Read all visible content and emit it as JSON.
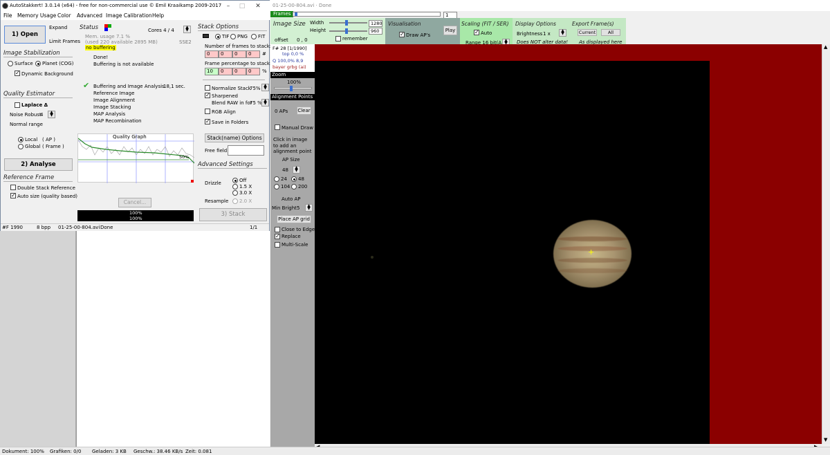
{
  "window": {
    "title": "AutoStakkert! 3.0.14 (x64) - free for non-commercial use © Emil Kraaikamp 2009-2017",
    "menu": [
      "File",
      "Memory Usage",
      "Color",
      "Advanced",
      "Image Calibration",
      "Help"
    ]
  },
  "left": {
    "open_label": "1) Open",
    "expand_label": "Expand",
    "limit_frames_label": "Limit Frames",
    "image_stabilization": "Image Stabilization",
    "surface_label": "Surface",
    "planet_label": "Planet (COG)",
    "dynamic_bg_label": "Dynamic Background",
    "quality_estimator": "Quality Estimator",
    "laplace_label": "Laplace Δ",
    "noise_robust_label": "Noise Robust",
    "noise_robust_value": "4",
    "normal_range_label": "Normal range",
    "local_label": "Local",
    "local_ap": "( AP )",
    "global_label": "Global",
    "global_frame": "( Frame )",
    "analyse_label": "2) Analyse",
    "reference_frame": "Reference Frame",
    "double_stack_label": "Double Stack Reference",
    "auto_size_label": "Auto size (quality based)"
  },
  "status": {
    "title": "Status",
    "cores": "Cores 4 / 4",
    "mem_usage": "Mem. usage 7.1 %",
    "mem_used": "(used 220 available 2895 MB)",
    "no_buffering": "no buffering",
    "sse": "SSE2",
    "done": "Done!",
    "buffering_na": "Buffering is not available",
    "steps": [
      "Buffering and Image Analysis",
      "Reference Image",
      "Image Alignment",
      "Image Stacking",
      "MAP Analysis",
      "MAP Recombination"
    ],
    "step_time": "18,1 sec.",
    "graph_title": "Quality Graph",
    "graph_pct": "50%",
    "cancel_label": "Cancel...",
    "progress1": "100%",
    "progress2": "100%"
  },
  "stack": {
    "title": "Stack Options",
    "tif": "TIF",
    "png": "PNG",
    "fit": "FIT",
    "frames_label": "Number of frames to stack:",
    "frames_vals": [
      "0",
      "0",
      "0",
      "0"
    ],
    "frames_unit": "#",
    "pct_label": "Frame percentage to stack:",
    "pct_vals": [
      "10",
      "0",
      "0",
      "0"
    ],
    "pct_unit": "%",
    "normalize_label": "Normalize Stack",
    "normalize_val": "75%",
    "sharpened_label": "Sharpened",
    "blend_label": "Blend RAW in for",
    "blend_val": "75 %",
    "rgb_label": "RGB Align",
    "save_label": "Save in Folders",
    "options_btn": "Stack(name) Options",
    "free_field_label": "Free field",
    "advanced": "Advanced Settings",
    "drizzle": "Drizzle",
    "off": "Off",
    "x15": "1.5 X",
    "x30": "3.0 X",
    "resample": "Resample",
    "x20": "2.0 X",
    "stack_btn": "3) Stack"
  },
  "statusbar": {
    "frame": "#F 1990",
    "bpp": "8 bpp",
    "file": "01-25-00-804.avi",
    "state": "Done",
    "page": "1/1"
  },
  "right": {
    "title": "01-25-00-804.avi · Done",
    "frames_label": "Frames",
    "frame_num": "1",
    "image_size": "Image Size",
    "width_label": "Width",
    "width_val": "1280",
    "height_label": "Height",
    "height_val": "960",
    "offset_label": "offset",
    "offset_val": "0 , 0",
    "remember": "remember",
    "visualisation": "Visualisation",
    "draw_aps": "Draw AP's",
    "play": "Play",
    "scaling": "Scaling (FIT / SER)",
    "auto": "Auto",
    "range": "Range 16 bit(A)",
    "display_options": "Display Options",
    "brightness": "Brightness",
    "brightness_val": "1 x",
    "not_alter": "Does NOT alter data!",
    "export": "Export Frame(s)",
    "current": "Current",
    "all": "All",
    "as_displayed": "As displayed here"
  },
  "sidebar": {
    "frame_info": "F# 28 [1/1990]",
    "top": "top 0,0 %",
    "q": "Q 100,0%",
    "q_val": "8,9",
    "bayer": "bayer grbg (ai)",
    "zoom": "Zoom",
    "zoom_val": "100%",
    "alignment": "Alignment Points",
    "aps": "0 APs",
    "clear": "Clear",
    "manual_draw": "Manual Draw",
    "click_hint": "Click in image to add an alignment point",
    "ap_size": "AP Size",
    "ap_size_val": "48",
    "s24": "24",
    "s48": "48",
    "s104": "104",
    "s200": "200",
    "auto_ap": "Auto AP",
    "min_bright": "Min Bright",
    "min_bright_val": "5",
    "place_grid": "Place AP grid",
    "close_edge": "Close to Edge",
    "replace": "Replace",
    "multi_scale": "Multi-Scale"
  },
  "browser_status": {
    "doc": "Dokument: 100%",
    "graf": "Grafiken: 0/0",
    "gel": "Geladen: 3 KB",
    "speed": "Geschw.: 38.46 KB/s",
    "zeit": "Zeit: 0.081"
  }
}
